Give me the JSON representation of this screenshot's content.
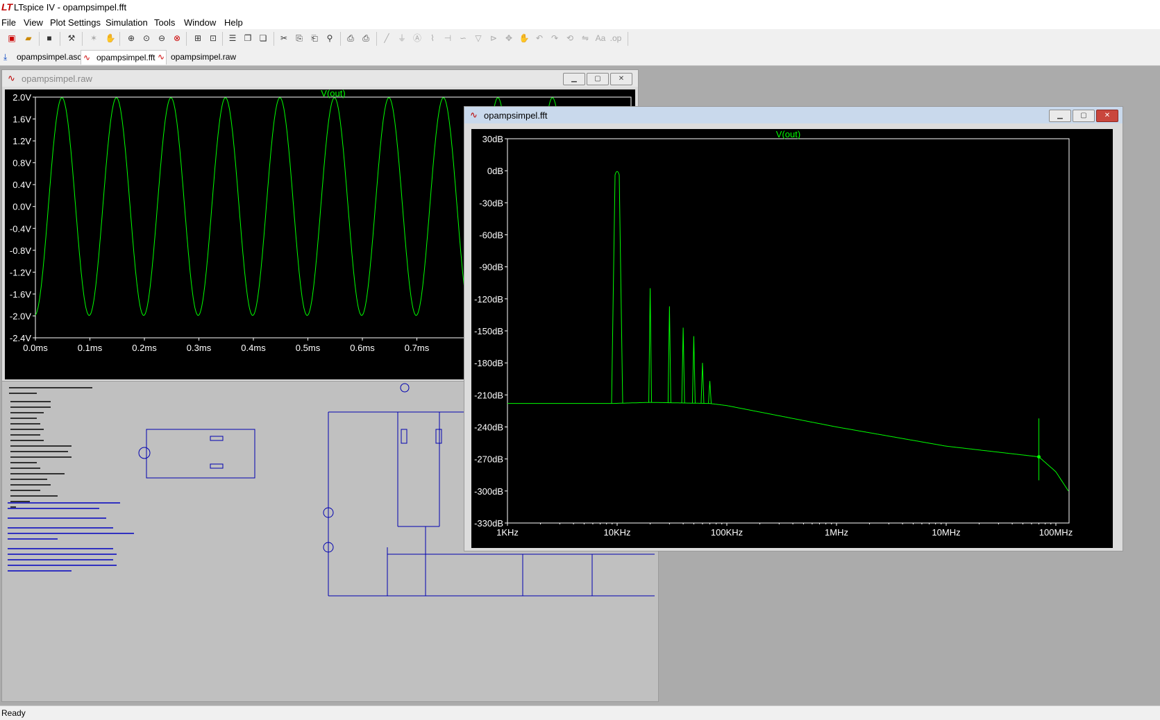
{
  "app": {
    "title": "LTspice IV - opampsimpel.fft"
  },
  "menu": [
    "File",
    "View",
    "Plot Settings",
    "Simulation",
    "Tools",
    "Window",
    "Help"
  ],
  "tabs": [
    {
      "label": "opampsimpel.asc",
      "icon": "schematic-icon"
    },
    {
      "label": "opampsimpel.fft",
      "icon": "waveform-icon"
    },
    {
      "label": "opampsimpel.raw",
      "icon": "waveform-icon"
    }
  ],
  "status": "Ready",
  "raw_window": {
    "title": "opampsimpel.raw",
    "chart_data": {
      "type": "line",
      "title": "V(out)",
      "xlabel": "",
      "ylabel": "",
      "x_ticks": [
        "0.0ms",
        "0.1ms",
        "0.2ms",
        "0.3ms",
        "0.4ms",
        "0.5ms",
        "0.6ms",
        "0.7ms"
      ],
      "y_ticks": [
        "2.0V",
        "1.6V",
        "1.2V",
        "0.8V",
        "0.4V",
        "0.0V",
        "-0.4V",
        "-0.8V",
        "-1.2V",
        "-1.6V",
        "-2.0V",
        "-2.4V"
      ],
      "xlim": [
        0.0,
        1.0
      ],
      "ylim": [
        -2.4,
        2.0
      ],
      "series": [
        {
          "name": "V(out)",
          "amplitude": 2.0,
          "frequency_khz": 10,
          "color": "#00ff00"
        }
      ],
      "grid": false
    }
  },
  "fft_window": {
    "title": "opampsimpel.fft",
    "chart_data": {
      "type": "line",
      "title": "V(out)",
      "xlabel": "",
      "ylabel": "",
      "x_scale": "log",
      "x_ticks": [
        "1KHz",
        "10KHz",
        "100KHz",
        "1MHz",
        "10MHz",
        "100MHz"
      ],
      "y_ticks": [
        "30dB",
        "0dB",
        "-30dB",
        "-60dB",
        "-90dB",
        "-120dB",
        "-150dB",
        "-180dB",
        "-210dB",
        "-240dB",
        "-270dB",
        "-300dB",
        "-330dB"
      ],
      "xlim_hz": [
        1000,
        130000000
      ],
      "ylim_db": [
        -330,
        30
      ],
      "noise_floor": [
        [
          1000,
          -218
        ],
        [
          9000,
          -218
        ],
        [
          20000,
          -217
        ],
        [
          70000,
          -218
        ],
        [
          100000,
          -220
        ],
        [
          1000000,
          -240
        ],
        [
          10000000,
          -258
        ],
        [
          70000000,
          -268
        ],
        [
          100000000,
          -282
        ],
        [
          130000000,
          -300
        ]
      ],
      "peaks": [
        {
          "freq_hz": 10000,
          "db": 0
        },
        {
          "freq_hz": 20000,
          "db": -110
        },
        {
          "freq_hz": 30000,
          "db": -127
        },
        {
          "freq_hz": 40000,
          "db": -147
        },
        {
          "freq_hz": 50000,
          "db": -155
        },
        {
          "freq_hz": 60000,
          "db": -180
        },
        {
          "freq_hz": 70000,
          "db": -197
        }
      ],
      "spur": {
        "freq_hz": 70000000,
        "db": -232
      },
      "color": "#00ff00",
      "grid": false
    }
  },
  "colors": {
    "trace": "#00ff00",
    "label": "#00ff00",
    "axis": "#ffffff",
    "schematic": "#0000b0"
  }
}
